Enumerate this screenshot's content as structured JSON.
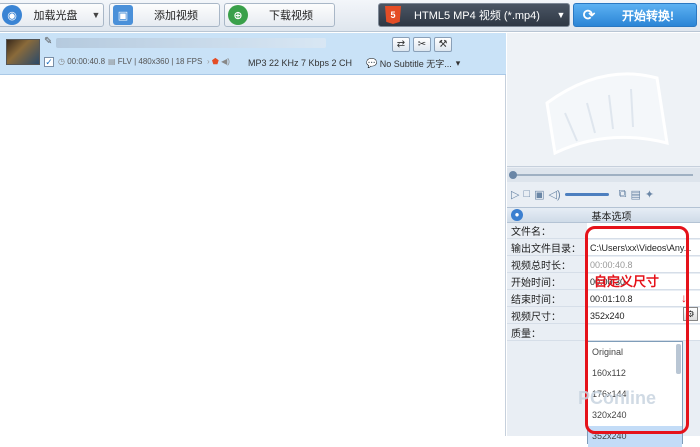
{
  "toolbar": {
    "load_disc": "加载光盘",
    "add_video": "添加视频",
    "download_video": "下载视频",
    "format_label": "HTML5 MP4 视频 (*.mp4)",
    "convert_label": "开始转换!"
  },
  "file_item": {
    "duration": "00:00:40.8",
    "info": "FLV | 480x360 | 18 FPS",
    "audio": "MP3 22 KHz 7 Kbps 2 CH",
    "subtitle": "No Subtitle 无字..."
  },
  "panel": {
    "section_title": "基本选项",
    "rows": [
      {
        "key": "文件名：",
        "value": ""
      },
      {
        "key": "输出文件目录：",
        "value": "C:\\Users\\xx\\Videos\\Any..."
      },
      {
        "key": "视频总时长：",
        "value": "00:00:40.8"
      },
      {
        "key": "开始时间：",
        "value": "00:00:30"
      },
      {
        "key": "结束时间：",
        "value": "00:01:10.8"
      },
      {
        "key": "视频尺寸：",
        "value": "352x240"
      },
      {
        "key": "质量：",
        "value": ""
      }
    ],
    "size_options": [
      "Original",
      "160x112",
      "176x144",
      "320x240",
      "352x240"
    ],
    "selected_size": "352x240"
  },
  "annotation": "自定义尺寸",
  "watermark": "PConline"
}
